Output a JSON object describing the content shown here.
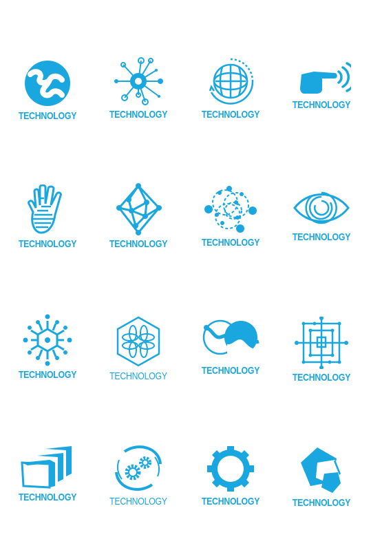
{
  "page": {
    "background": "#ffffff",
    "accent_color": "#1aa7e0"
  },
  "logos": [
    {
      "icon": "molecule-globe-icon",
      "label": "TECHNOLOGY"
    },
    {
      "icon": "network-node-icon",
      "label": "TECHNOLOGY"
    },
    {
      "icon": "rotating-globe-icon",
      "label": "TECHNOLOGY"
    },
    {
      "icon": "pointing-hand-signal-icon",
      "label": "TECHNOLOGY"
    },
    {
      "icon": "circuit-hand-icon",
      "label": "TECHNOLOGY"
    },
    {
      "icon": "mesh-diamond-icon",
      "label": "TECHNOLOGY"
    },
    {
      "icon": "orbit-atoms-icon",
      "label": "TECHNOLOGY"
    },
    {
      "icon": "eye-icon",
      "label": "TECHNOLOGY"
    },
    {
      "icon": "snowflake-network-icon",
      "label": "TECHNOLOGY"
    },
    {
      "icon": "hexagon-petals-icon",
      "label": "TECHNOLOGY"
    },
    {
      "icon": "wave-circles-icon",
      "label": "TECHNOLOGY"
    },
    {
      "icon": "square-maze-icon",
      "label": "TECHNOLOGY"
    },
    {
      "icon": "stacked-boxes-icon",
      "label": "TECHNOLOGY"
    },
    {
      "icon": "gears-orbit-icon",
      "label": "TECHNOLOGY"
    },
    {
      "icon": "gear-icon",
      "label": "TECHNOLOGY"
    },
    {
      "icon": "pentagons-icon",
      "label": "TECHNOLOGY"
    }
  ]
}
